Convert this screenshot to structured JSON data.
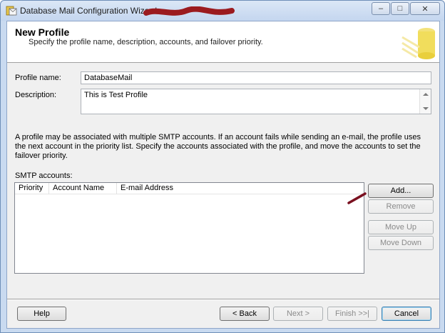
{
  "window": {
    "title": "Database Mail Configuration Wizard",
    "controls": {
      "minimize": "–",
      "maximize": "□",
      "close": "✕"
    }
  },
  "header": {
    "title": "New Profile",
    "subtitle": "Specify the profile name, description, accounts, and failover priority.",
    "art_icon": "database-mail-icon"
  },
  "form": {
    "profile_name_label": "Profile name:",
    "profile_name_value": "DatabaseMail",
    "description_label": "Description:",
    "description_value": "This is Test Profile"
  },
  "info_text": "A profile may be associated with multiple SMTP accounts. If an account fails while sending an e-mail, the profile uses the next account in the priority list. Specify the accounts associated with the profile, and move the accounts to set the failover priority.",
  "smtp": {
    "label": "SMTP accounts:",
    "columns": [
      "Priority",
      "Account Name",
      "E-mail Address"
    ],
    "rows": []
  },
  "side_buttons": {
    "add": "Add...",
    "remove": "Remove",
    "move_up": "Move Up",
    "move_down": "Move Down"
  },
  "footer": {
    "help": "Help",
    "back": "< Back",
    "next": "Next >",
    "finish": "Finish >>|",
    "cancel": "Cancel"
  },
  "colors": {
    "title_bar": "#c4d6ef",
    "dialog_bg": "#f0f0f0",
    "annotation_mark": "#7a1020"
  }
}
